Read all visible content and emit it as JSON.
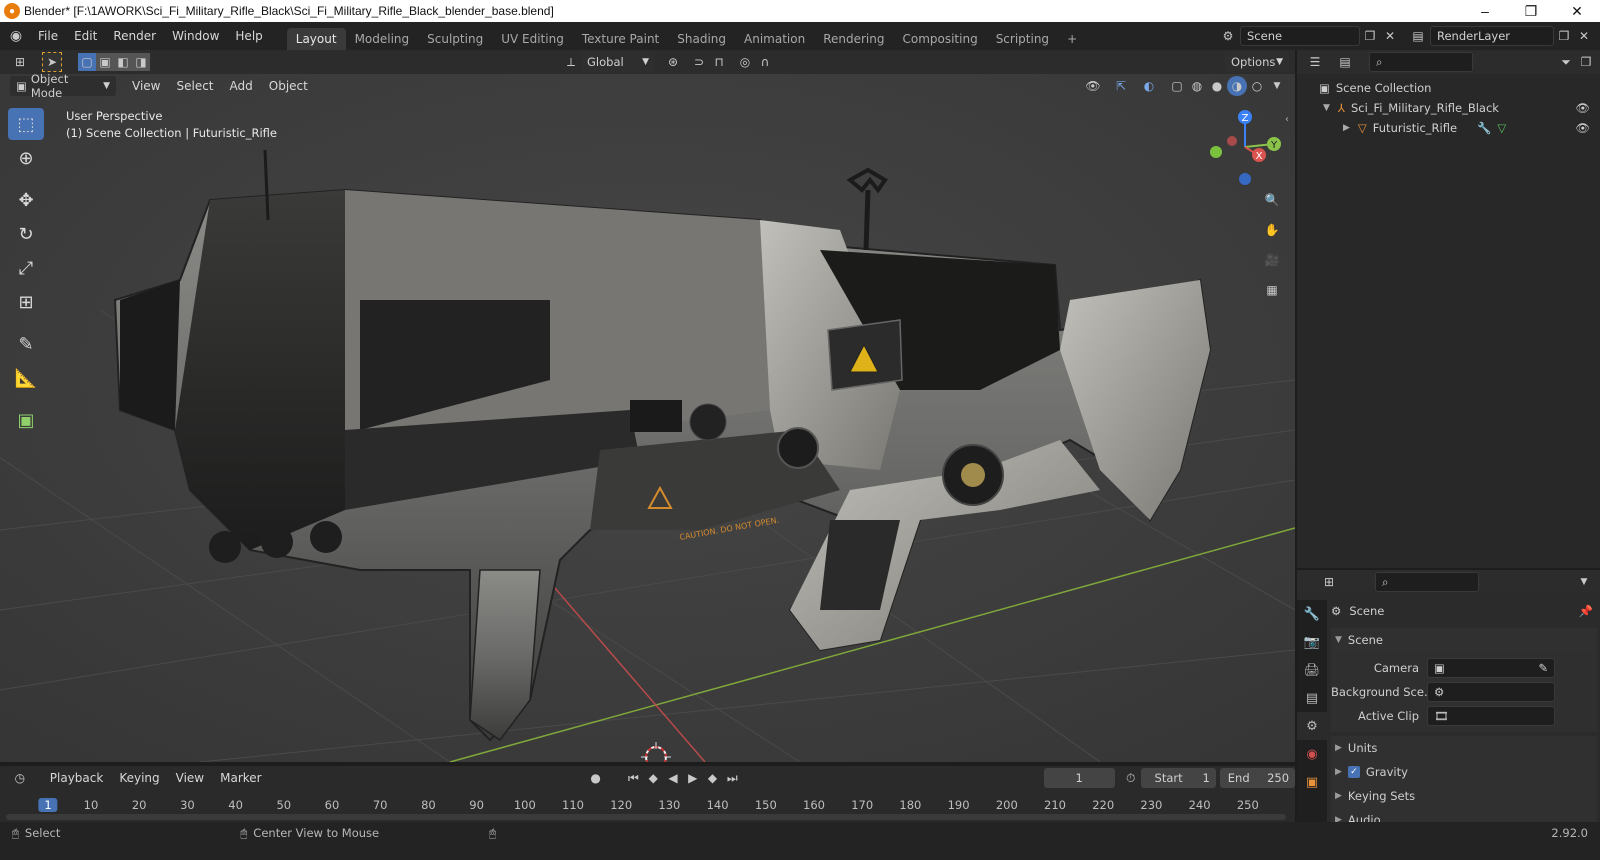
{
  "window": {
    "title": "Blender* [F:\\1AWORK\\Sci_Fi_Military_Rifle_Black\\Sci_Fi_Military_Rifle_Black_blender_base.blend]",
    "minimize": "–",
    "maximize": "❐",
    "close": "✕"
  },
  "menu": [
    "File",
    "Edit",
    "Render",
    "Window",
    "Help"
  ],
  "workspaces": [
    "Layout",
    "Modeling",
    "Sculpting",
    "UV Editing",
    "Texture Paint",
    "Shading",
    "Animation",
    "Rendering",
    "Compositing",
    "Scripting"
  ],
  "add_workspace": "+",
  "scene_name": "Scene",
  "render_layer": "RenderLayer",
  "viewport": {
    "transform_orientation": "Global",
    "options_label": "Options",
    "mode": "Object Mode",
    "menus": [
      "View",
      "Select",
      "Add",
      "Object"
    ],
    "overlay_line1": "User Perspective",
    "overlay_line2": "(1) Scene Collection | Futuristic_Rifle",
    "gizmo": {
      "z": "Z",
      "y": "Y",
      "x": "X"
    },
    "warning_label": "CAUTION. DO NOT OPEN."
  },
  "outliner": {
    "root": "Scene Collection",
    "items": [
      {
        "label": "Sci_Fi_Military_Rifle_Black"
      },
      {
        "label": "Futuristic_Rifle"
      }
    ]
  },
  "properties": {
    "header": "Scene",
    "panel": "Scene",
    "fields": [
      {
        "label": "Camera"
      },
      {
        "label": "Background Sce..."
      },
      {
        "label": "Active Clip"
      }
    ],
    "sections": [
      "Units",
      "Gravity",
      "Keying Sets",
      "Audio"
    ]
  },
  "timeline": {
    "menus": [
      "Playback",
      "Keying",
      "View",
      "Marker"
    ],
    "current_frame": "1",
    "start_label": "Start",
    "start": "1",
    "end_label": "End",
    "end": "250",
    "ticks": [
      "1",
      "10",
      "20",
      "30",
      "40",
      "50",
      "60",
      "70",
      "80",
      "90",
      "100",
      "110",
      "120",
      "130",
      "140",
      "150",
      "160",
      "170",
      "180",
      "190",
      "200",
      "210",
      "220",
      "230",
      "240",
      "250"
    ]
  },
  "status": {
    "select": "Select",
    "center_view": "Center View to Mouse",
    "version": "2.92.0"
  },
  "colors": {
    "accent": "#4772b3",
    "x_axis": "#d9534f",
    "y_axis": "#8bc34a",
    "z_axis": "#3b82f6"
  }
}
